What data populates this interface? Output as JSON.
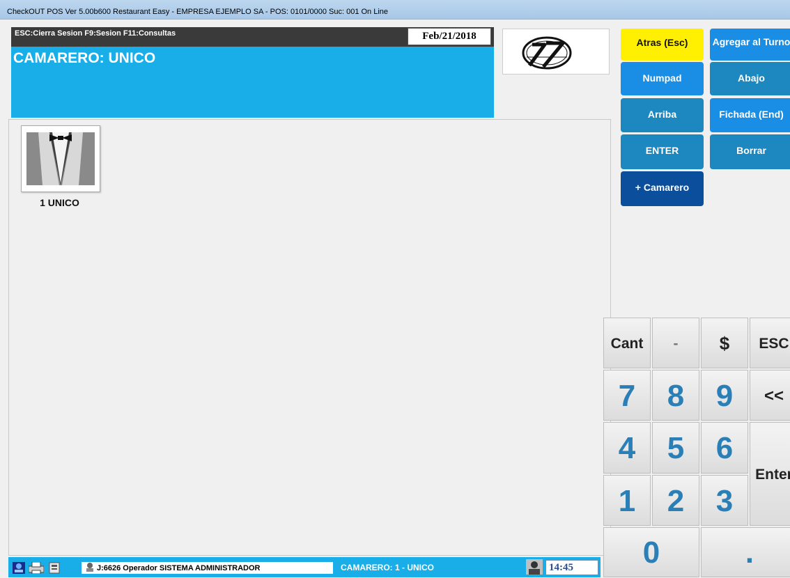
{
  "window": {
    "title": "CheckOUT POS Ver 5.00b600 Restaurant Easy - EMPRESA EJEMPLO SA - POS: 0101/0000 Suc: 001  On Line"
  },
  "header": {
    "shortcuts": "ESC:Cierra Sesion F9:Sesion F11:Consultas",
    "date": "Feb/21/2018",
    "waiter_label": "CAMARERO:  UNICO"
  },
  "waiters": [
    {
      "name": "1  UNICO",
      "icon": "tuxedo-icon"
    }
  ],
  "actions": {
    "atras": "Atras (Esc)",
    "agregar": "Agregar al Turno",
    "numpad": "Numpad",
    "abajo": "Abajo",
    "arriba": "Arriba",
    "fichada": "Fichada (End)",
    "enter": "ENTER",
    "borrar": "Borrar",
    "camarero": "+ Camarero"
  },
  "numpad": {
    "cant": "Cant",
    "minus": "-",
    "dollar": "$",
    "esc": "ESC",
    "d7": "7",
    "d8": "8",
    "d9": "9",
    "back": "<<",
    "d4": "4",
    "d5": "5",
    "d6": "6",
    "enter": "Enter",
    "d1": "1",
    "d2": "2",
    "d3": "3",
    "d0": "0",
    "dot": "."
  },
  "status": {
    "operator": "J:6626 Operador  SISTEMA ADMINISTRADOR",
    "camarero": "CAMARERO: 1 - UNICO",
    "time": "14:45"
  },
  "colors": {
    "accent_blue": "#19aee8",
    "button_blue": "#1a8ee4",
    "button_teal": "#1c88bf",
    "button_navy": "#0b4f9c",
    "button_yellow": "#ffef00",
    "digit_blue": "#2a7fb6"
  }
}
